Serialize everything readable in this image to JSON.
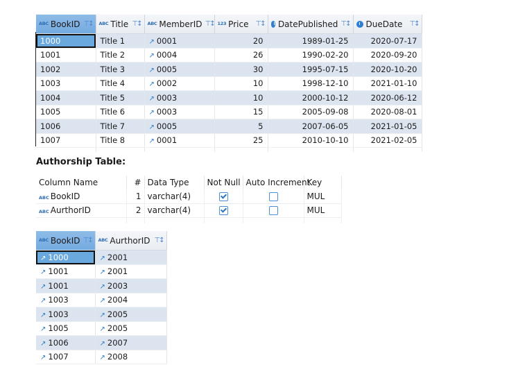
{
  "books_table": {
    "columns": [
      {
        "type_icon": "ABC",
        "label": "BookID"
      },
      {
        "type_icon": "ABC",
        "label": "Title"
      },
      {
        "type_icon": "ABC",
        "label": "MemberID"
      },
      {
        "type_icon": "123",
        "label": "Price"
      },
      {
        "type_icon": "clock",
        "label": "DatePublished"
      },
      {
        "type_icon": "clock",
        "label": "DueDate"
      }
    ],
    "rows": [
      {
        "BookID": "1000",
        "Title": "Title 1",
        "MemberID": "0001",
        "Price": "20",
        "DatePublished": "1989-01-25",
        "DueDate": "2020-07-17"
      },
      {
        "BookID": "1001",
        "Title": "Title 2",
        "MemberID": "0004",
        "Price": "26",
        "DatePublished": "1990-02-20",
        "DueDate": "2020-09-20"
      },
      {
        "BookID": "1002",
        "Title": "Title 3",
        "MemberID": "0005",
        "Price": "30",
        "DatePublished": "1995-07-15",
        "DueDate": "2020-10-20"
      },
      {
        "BookID": "1003",
        "Title": "Title 4",
        "MemberID": "0002",
        "Price": "10",
        "DatePublished": "1998-12-10",
        "DueDate": "2021-01-10"
      },
      {
        "BookID": "1004",
        "Title": "Title 5",
        "MemberID": "0003",
        "Price": "10",
        "DatePublished": "2000-10-12",
        "DueDate": "2020-06-12"
      },
      {
        "BookID": "1005",
        "Title": "Title 6",
        "MemberID": "0003",
        "Price": "15",
        "DatePublished": "2005-09-08",
        "DueDate": "2020-08-01"
      },
      {
        "BookID": "1006",
        "Title": "Title 7",
        "MemberID": "0005",
        "Price": "5",
        "DatePublished": "2007-06-05",
        "DueDate": "2021-01-05"
      },
      {
        "BookID": "1007",
        "Title": "Title 8",
        "MemberID": "0001",
        "Price": "25",
        "DatePublished": "2010-10-10",
        "DueDate": "2021-02-05"
      }
    ]
  },
  "authorship": {
    "heading": "Authorship Table:",
    "schema_headers": {
      "column_name": "Column Name",
      "num": "#",
      "data_type": "Data Type",
      "not_null": "Not Null",
      "auto_increment": "Auto Increment",
      "key": "Key"
    },
    "schema_rows": [
      {
        "name": "BookID",
        "num": "1",
        "data_type": "varchar(4)",
        "not_null": true,
        "auto_increment": false,
        "key": "MUL"
      },
      {
        "name": "AurthorID",
        "num": "2",
        "data_type": "varchar(4)",
        "not_null": true,
        "auto_increment": false,
        "key": "MUL"
      }
    ],
    "data_columns": [
      {
        "type_icon": "ABC",
        "label": "BookID"
      },
      {
        "type_icon": "ABC",
        "label": "AurthorID"
      }
    ],
    "data_rows": [
      {
        "BookID": "1000",
        "AurthorID": "2001"
      },
      {
        "BookID": "1001",
        "AurthorID": "2001"
      },
      {
        "BookID": "1001",
        "AurthorID": "2003"
      },
      {
        "BookID": "1003",
        "AurthorID": "2004"
      },
      {
        "BookID": "1003",
        "AurthorID": "2005"
      },
      {
        "BookID": "1005",
        "AurthorID": "2005"
      },
      {
        "BookID": "1006",
        "AurthorID": "2007"
      },
      {
        "BookID": "1007",
        "AurthorID": "2008"
      }
    ]
  },
  "icons": {
    "type_abc": "ABC",
    "type_num": "123",
    "fk_link": "↗",
    "sort_filter": "⊤↕"
  },
  "colors": {
    "selection": "#6aa9dd",
    "alt_row": "#dce5ef",
    "accent": "#2e7fc9"
  }
}
